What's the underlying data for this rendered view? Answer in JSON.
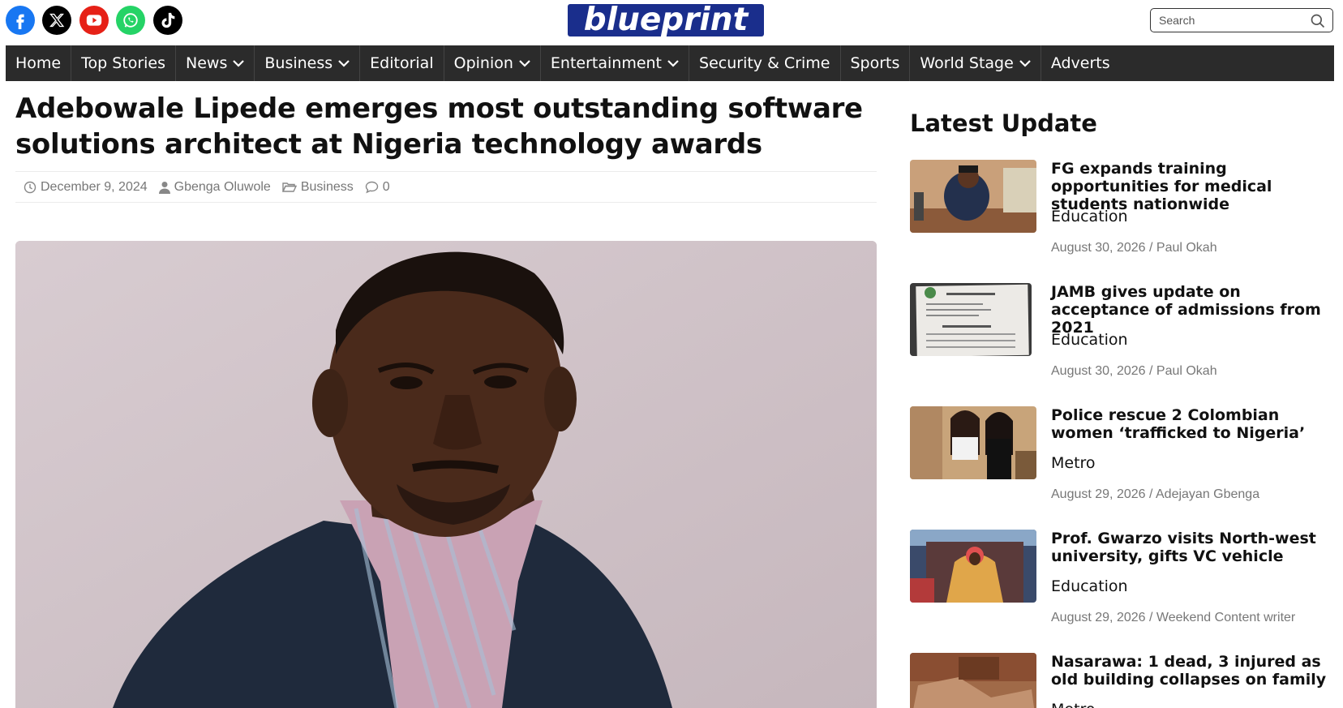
{
  "social": [
    {
      "name": "facebook-icon",
      "color": "#1877f2"
    },
    {
      "name": "x-icon",
      "color": "#000000"
    },
    {
      "name": "youtube-icon",
      "color": "#e62117"
    },
    {
      "name": "whatsapp-icon",
      "color": "#25d366"
    },
    {
      "name": "tiktok-icon",
      "color": "#000000"
    }
  ],
  "header": {
    "logo_text": "blueprint",
    "logo_color": "#1a2e8c",
    "search_placeholder": "Search"
  },
  "nav": {
    "items": [
      {
        "label": "Home",
        "has_dropdown": false
      },
      {
        "label": "Top Stories",
        "has_dropdown": false
      },
      {
        "label": "News",
        "has_dropdown": true
      },
      {
        "label": "Business",
        "has_dropdown": true
      },
      {
        "label": "Editorial",
        "has_dropdown": false
      },
      {
        "label": "Opinion",
        "has_dropdown": true
      },
      {
        "label": "Entertainment",
        "has_dropdown": true
      },
      {
        "label": "Security & Crime",
        "has_dropdown": false
      },
      {
        "label": "Sports",
        "has_dropdown": false
      },
      {
        "label": "World Stage",
        "has_dropdown": true
      },
      {
        "label": "Adverts",
        "has_dropdown": false
      }
    ]
  },
  "article": {
    "title": "Adebowale Lipede emerges most outstanding software solutions architect at Nigeria technology awards",
    "date": "December 9, 2024",
    "author": "Gbenga Oluwole",
    "category": "Business",
    "comments": "0"
  },
  "sidebar": {
    "title": "Latest Update",
    "posts": [
      {
        "title": "FG expands training opportunities for medical students nationwide",
        "category": "Education",
        "date": "August 30, 2026",
        "author": "Paul Okah"
      },
      {
        "title": "JAMB gives update on acceptance of admissions from 2021",
        "category": "Education",
        "date": "August 30, 2026",
        "author": "Paul Okah"
      },
      {
        "title": "Police rescue 2 Colombian women ‘trafficked to Nigeria’",
        "category": "Metro",
        "date": "August 29, 2026",
        "author": "Adejayan Gbenga"
      },
      {
        "title": "Prof. Gwarzo visits North-west university, gifts VC vehicle",
        "category": "Education",
        "date": "August 29, 2026",
        "author": "Weekend Content writer"
      },
      {
        "title": "Nasarawa: 1 dead, 3 injured as old building collapses on family",
        "category": "Metro",
        "date": "",
        "author": ""
      }
    ]
  }
}
